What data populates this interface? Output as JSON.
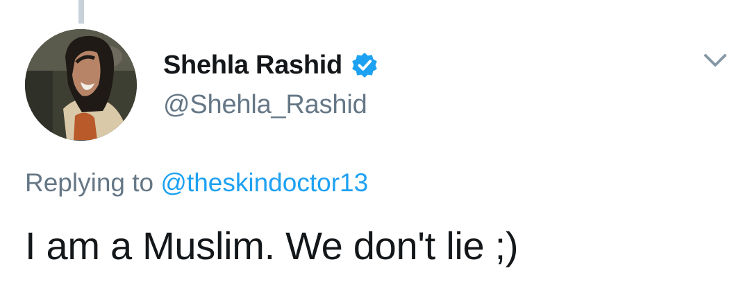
{
  "tweet": {
    "author": {
      "display_name": "Shehla Rashid",
      "handle": "@Shehla_Rashid",
      "verified": true,
      "avatar_icon": "profile-photo"
    },
    "reply_context": {
      "prefix": "Replying to",
      "target_handle": "@theskindoctor13"
    },
    "text": "I am a Muslim. We don't lie ;)",
    "menu_icon": "chevron-down-icon"
  },
  "colors": {
    "text_primary": "#14171a",
    "text_secondary": "#657786",
    "link": "#1da1f2",
    "verified_badge": "#1da1f2",
    "thread_line": "#c8d1d9",
    "chevron": "#8899a6"
  }
}
